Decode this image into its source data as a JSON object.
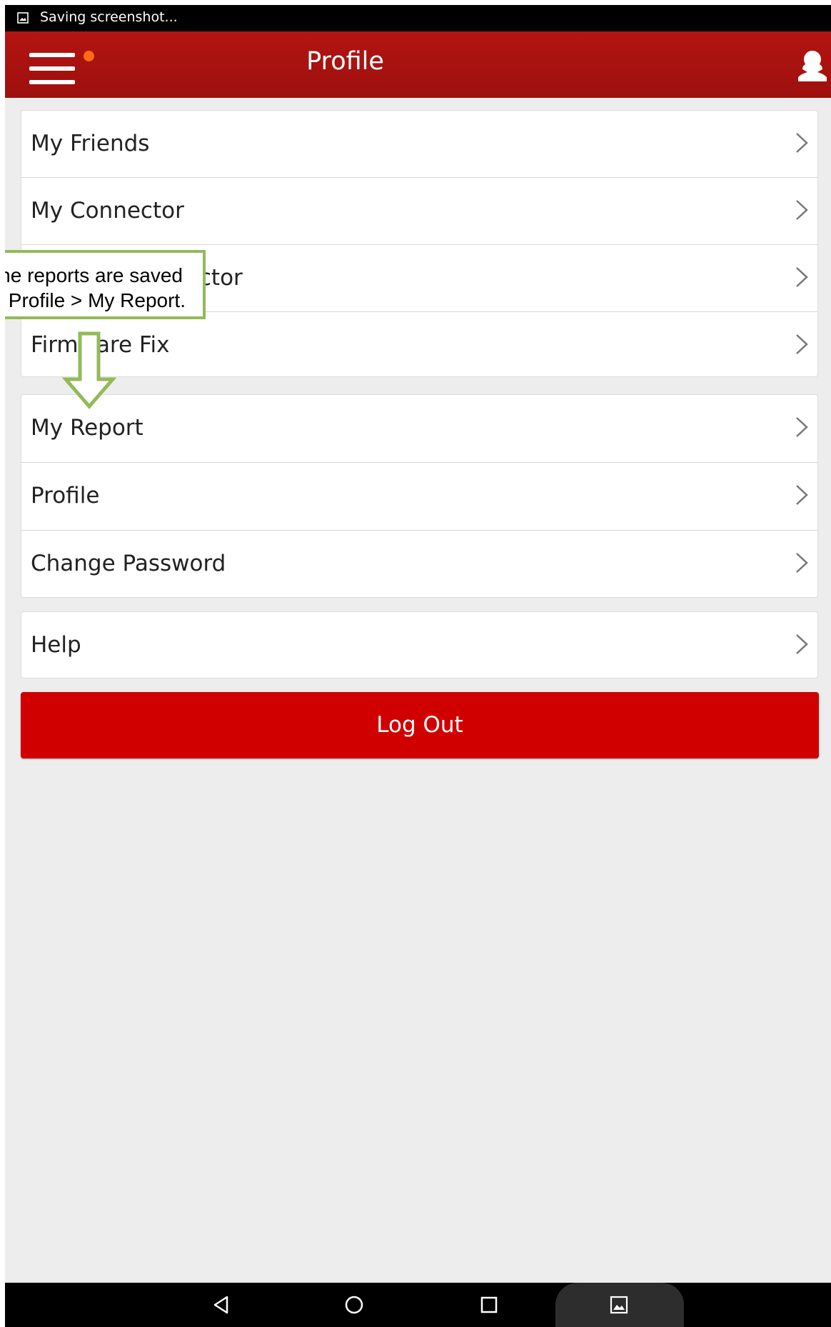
{
  "status_bar": {
    "text": "Saving screenshot..."
  },
  "app_bar": {
    "title": "Profile"
  },
  "menu_groups": [
    {
      "items": [
        {
          "label": "My Friends"
        },
        {
          "label": "My Connector"
        },
        {
          "label": "Activate Connector"
        },
        {
          "label": "Firmware Fix"
        }
      ]
    },
    {
      "items": [
        {
          "label": "My Report"
        },
        {
          "label": "Profile"
        },
        {
          "label": "Change Password"
        }
      ]
    },
    {
      "items": [
        {
          "label": "Help"
        }
      ]
    }
  ],
  "logout": {
    "label": "Log Out"
  },
  "annotation": {
    "line1": "The reports are saved",
    "line2": "in Profile > My Report."
  },
  "colors": {
    "app_bar": "#a81210",
    "logout": "#d00000",
    "notification_dot": "#ff6a13",
    "callout_border": "#92ba5a"
  },
  "icons": [
    "image-icon",
    "hamburger-menu-icon",
    "user-icon",
    "chevron-right-icon",
    "back-icon",
    "home-icon",
    "recents-icon",
    "screenshot-icon"
  ]
}
